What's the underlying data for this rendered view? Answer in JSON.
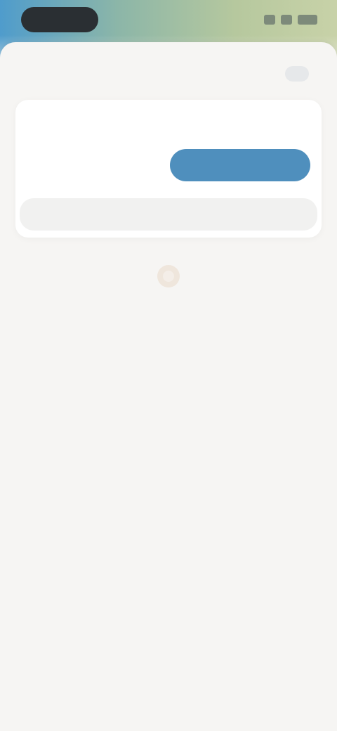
{
  "status_bar": {
    "time": "",
    "icons": [
      "signal-icon",
      "wifi-icon",
      "battery-icon"
    ]
  },
  "sheet": {
    "close_icon": "close-icon"
  },
  "card": {
    "title": "",
    "secondary_label": "",
    "primary_label": "",
    "bottom_label": ""
  },
  "empty_state": {
    "icon": "empty-state-icon",
    "title": "",
    "subtitle": ""
  },
  "colors": {
    "accent": "#4f8fbd",
    "background": "#f6f5f3",
    "card": "#ffffff"
  }
}
